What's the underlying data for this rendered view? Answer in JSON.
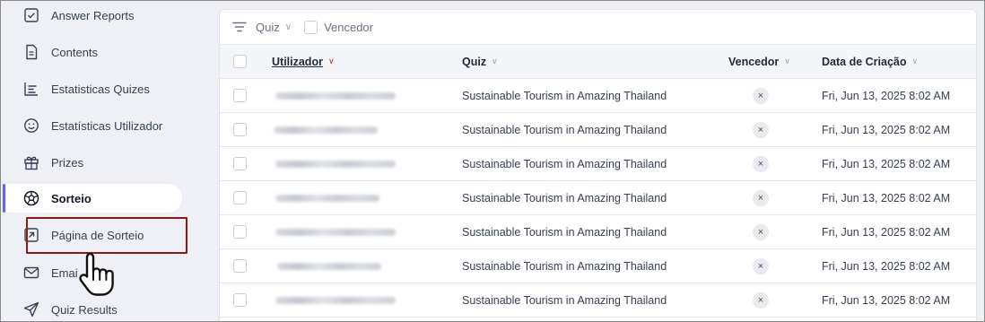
{
  "sidebar": {
    "items": [
      {
        "label": "Answer Reports",
        "icon": "checkbox-icon"
      },
      {
        "label": "Contents",
        "icon": "document-icon"
      },
      {
        "label": "Estatisticas Quizes",
        "icon": "list-chart-icon"
      },
      {
        "label": "Estatísticas Utilizador",
        "icon": "smiley-icon"
      },
      {
        "label": "Prizes",
        "icon": "gift-icon"
      },
      {
        "label": "Sorteio",
        "icon": "ball-icon"
      },
      {
        "label": "Página de Sorteio",
        "icon": "external-link-icon"
      },
      {
        "label": "Emai",
        "icon": "mail-icon"
      },
      {
        "label": "Quiz Results",
        "icon": "send-icon"
      }
    ],
    "active": "Sorteio",
    "highlighted": "Página de Sorteio"
  },
  "toolbar": {
    "quiz_filter": "Quiz",
    "winner_filter": "Vencedor"
  },
  "table": {
    "headers": {
      "user": "Utilizador",
      "quiz": "Quiz",
      "winner": "Vencedor",
      "created": "Data de Criação"
    },
    "rows": [
      {
        "quiz": "Sustainable Tourism in Amazing Thailand",
        "winner": "×",
        "created": "Fri, Jun 13, 2025 8:02 AM"
      },
      {
        "quiz": "Sustainable Tourism in Amazing Thailand",
        "winner": "×",
        "created": "Fri, Jun 13, 2025 8:02 AM"
      },
      {
        "quiz": "Sustainable Tourism in Amazing Thailand",
        "winner": "×",
        "created": "Fri, Jun 13, 2025 8:02 AM"
      },
      {
        "quiz": "Sustainable Tourism in Amazing Thailand",
        "winner": "×",
        "created": "Fri, Jun 13, 2025 8:02 AM"
      },
      {
        "quiz": "Sustainable Tourism in Amazing Thailand",
        "winner": "×",
        "created": "Fri, Jun 13, 2025 8:02 AM"
      },
      {
        "quiz": "Sustainable Tourism in Amazing Thailand",
        "winner": "×",
        "created": "Fri, Jun 13, 2025 8:02 AM"
      },
      {
        "quiz": "Sustainable Tourism in Amazing Thailand",
        "winner": "×",
        "created": "Fri, Jun 13, 2025 8:02 AM"
      }
    ]
  },
  "colors": {
    "accent": "#6366f1",
    "highlight": "#8b1a1a",
    "sort_active": "#dc2626"
  }
}
